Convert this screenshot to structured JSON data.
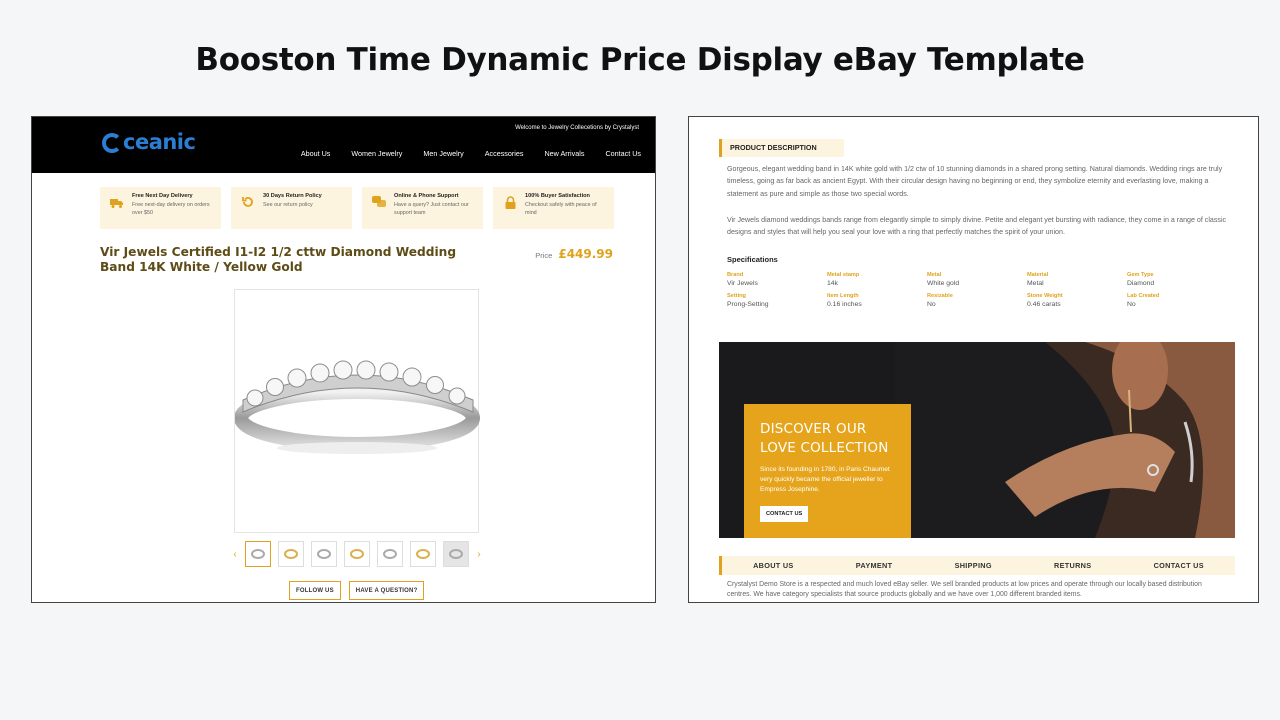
{
  "page_title": "Booston Time Dynamic Price Display eBay Template",
  "store": {
    "logo_text": "ceanic",
    "welcome": "Welcome to Jewelry Collecetions by Crystalyst",
    "nav": [
      "About Us",
      "Women Jewelry",
      "Men Jewelry",
      "Accessories",
      "New Arrivals",
      "Contact Us"
    ]
  },
  "features": [
    {
      "title": "Free Next Day Delivery",
      "sub": "Free next-day delivery on orders over $50",
      "icon": "truck-icon"
    },
    {
      "title": "30 Days Return Policy",
      "sub": "See our return policy",
      "icon": "return-icon"
    },
    {
      "title": "Online & Phone Support",
      "sub": "Have a query? Just contact our support team",
      "icon": "chat-icon"
    },
    {
      "title": "100% Buyer Satisfaction",
      "sub": "Checkout safely with peace of mind",
      "icon": "lock-icon"
    }
  ],
  "product": {
    "title": "Vir Jewels Certified I1-I2 1/2 cttw Diamond Wedding Band 14K White / Yellow Gold",
    "price_label": "Price",
    "price": "£449.99",
    "thumb_count": 7
  },
  "buttons": {
    "follow": "FOLLOW US",
    "question": "HAVE A QUESTION?"
  },
  "description": {
    "heading": "PRODUCT DESCRIPTION",
    "p1": "Gorgeous, elegant wedding band in 14K white gold with 1/2 ctw of 10 stunning diamonds in a shared prong setting. Natural diamonds. Wedding rings are truly timeless, going as far back as ancient Egypt. With their circular design having no beginning or end, they symbolize eternity and everlasting love, making a statement as pure and simple as those two special words.",
    "p2": "Vir Jewels diamond weddings bands range from elegantly simple to simply divine. Petite and elegant yet bursting with radiance, they come in a range of classic designs and styles that will help you seal your love with a ring that perfectly matches the spirit of your union."
  },
  "specs": {
    "title": "Specifications",
    "items": [
      {
        "k": "Brand",
        "v": "Vir Jewels"
      },
      {
        "k": "Metal stamp",
        "v": "14k"
      },
      {
        "k": "Metal",
        "v": "White gold"
      },
      {
        "k": "Material",
        "v": "Metal"
      },
      {
        "k": "Gem Type",
        "v": "Diamond"
      },
      {
        "k": "Setting",
        "v": "Prong-Setting"
      },
      {
        "k": "Item Length",
        "v": "0.16 inches"
      },
      {
        "k": "Resizable",
        "v": "No"
      },
      {
        "k": "Stone Weight",
        "v": "0.46 carats"
      },
      {
        "k": "Lab Created",
        "v": "No"
      }
    ]
  },
  "banner": {
    "heading_line1": "DISCOVER OUR",
    "heading_line2": "LOVE COLLECTION",
    "text": "Since its founding in 1780, in Paris Chaumet very quickly became the official jeweller to Empress Josephine.",
    "button": "CONTACT US"
  },
  "tabs": [
    "ABOUT US",
    "PAYMENT",
    "SHIPPING",
    "RETURNS",
    "CONTACT US"
  ],
  "about": "Crystalyst Demo Store is a respected and much loved eBay seller. We sell branded products at low prices and operate through our locally based distribution centres. We have category specialists that source products globally and we have over 1,000 different branded items.",
  "colors": {
    "accent": "#e0a21c",
    "title_brown": "#5e4c17",
    "logo_blue": "#2a7fd4",
    "cream": "#fdf4e0"
  }
}
